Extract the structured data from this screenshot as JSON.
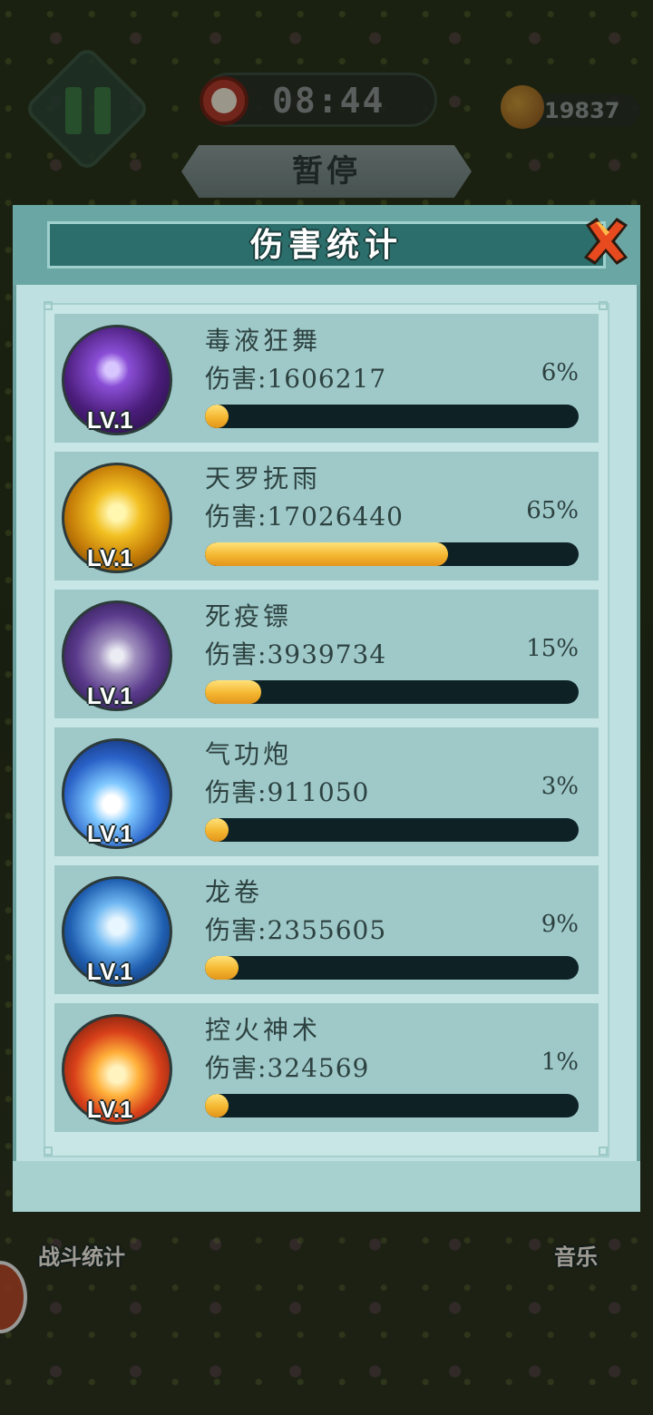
{
  "hud": {
    "timer": "08:44",
    "coins": "19837",
    "pause_title": "暂停"
  },
  "panel": {
    "title": "伤害统计",
    "damage_prefix": "伤害:",
    "skills": [
      {
        "name": "毒液狂舞",
        "damage": "1606217",
        "percent": "6%",
        "level": "LV.1",
        "fill": 0.06,
        "icon": "poison-dance-icon"
      },
      {
        "name": "天罗抚雨",
        "damage": "17026440",
        "percent": "65%",
        "level": "LV.1",
        "fill": 0.65,
        "icon": "golden-fan-icon"
      },
      {
        "name": "死疫镖",
        "damage": "3939734",
        "percent": "15%",
        "level": "LV.1",
        "fill": 0.15,
        "icon": "shuriken-icon"
      },
      {
        "name": "气功炮",
        "damage": "911050",
        "percent": "3%",
        "level": "LV.1",
        "fill": 0.03,
        "icon": "qi-blast-icon"
      },
      {
        "name": "龙卷",
        "damage": "2355605",
        "percent": "9%",
        "level": "LV.1",
        "fill": 0.09,
        "icon": "tornado-icon"
      },
      {
        "name": "控火神术",
        "damage": "324569",
        "percent": "1%",
        "level": "LV.1",
        "fill": 0.01,
        "icon": "fire-control-icon"
      }
    ]
  },
  "bottom": {
    "battle_stats": "战斗统计",
    "music": "音乐"
  },
  "colors": {
    "bar_fill": "#f4b630",
    "bar_track": "#0e2226",
    "panel_bg": "#bfe0e0",
    "header": "#2b6e6b"
  }
}
